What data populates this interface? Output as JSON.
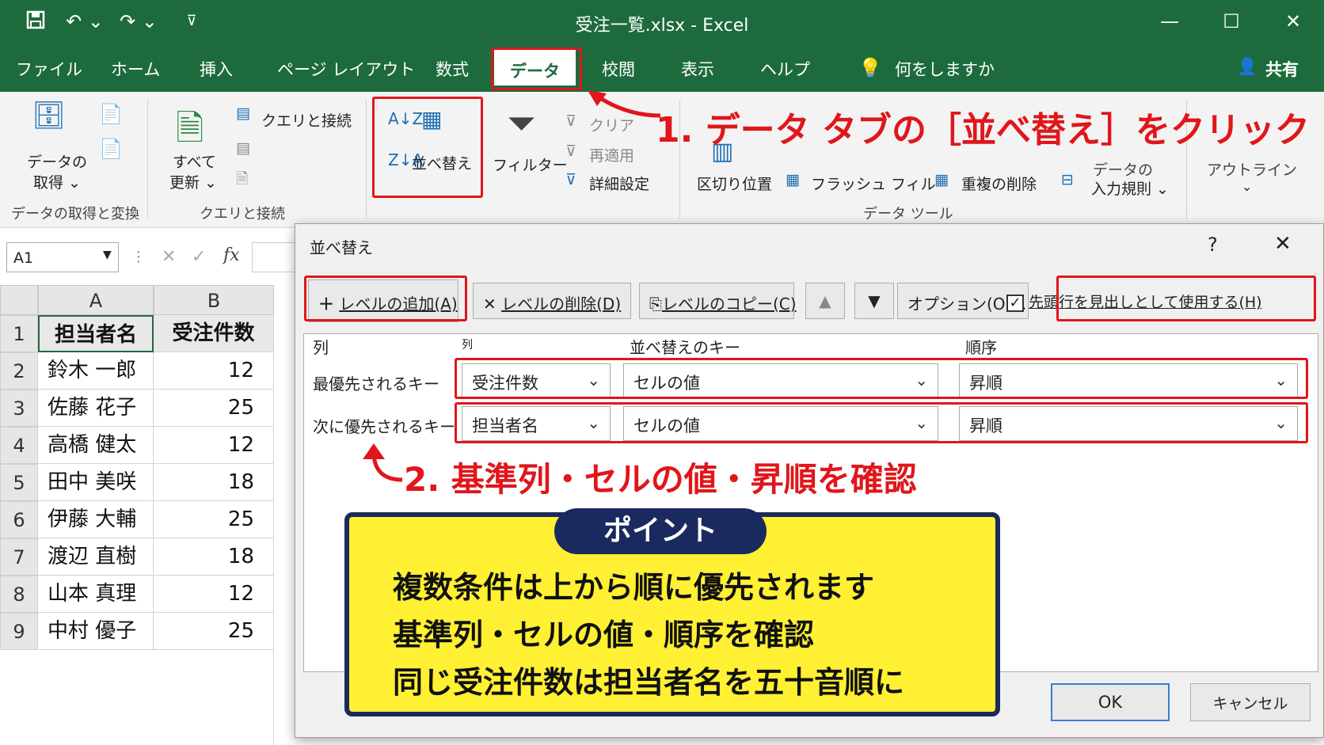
{
  "window": {
    "title": "受注一覧.xlsx - Excel"
  },
  "tabs": [
    "ファイル",
    "ホーム",
    "挿入",
    "ページ レイアウト",
    "数式",
    "データ",
    "校閲",
    "表示",
    "ヘルプ"
  ],
  "tell_me": "何をしますか",
  "share": "共有",
  "ribbon": {
    "get_data": [
      "データの",
      "取得 ⌄"
    ],
    "refresh_all": [
      "すべて",
      "更新 ⌄"
    ],
    "queries": "クエリと接続",
    "sort": "並べ替え",
    "filter": "フィルター",
    "clear": "クリア",
    "reapply": "再適用",
    "advanced": "詳細設定",
    "text_to_columns": "区切り位置",
    "flash_fill": "フラッシュ フィル",
    "remove_dup": "重複の削除",
    "validation": [
      "データの",
      "入力規則 ⌄"
    ],
    "outline": "アウトライン",
    "groups": {
      "get_transform": "データの取得と変換",
      "queries": "クエリと接続",
      "data_tools": "データ ツール"
    }
  },
  "formula_bar": {
    "name_box": "A1",
    "fx": "fx"
  },
  "sheet": {
    "columns": [
      "A",
      "B"
    ],
    "rows": [
      [
        "1",
        "担当者名",
        "受注件数"
      ],
      [
        "2",
        "鈴木 一郎",
        "12"
      ],
      [
        "3",
        "佐藤 花子",
        "25"
      ],
      [
        "4",
        "高橋 健太",
        "12"
      ],
      [
        "5",
        "田中 美咲",
        "18"
      ],
      [
        "6",
        "伊藤 大輔",
        "25"
      ],
      [
        "7",
        "渡辺 直樹",
        "18"
      ],
      [
        "8",
        "山本 真理",
        "12"
      ],
      [
        "9",
        "中村 優子",
        "25"
      ]
    ]
  },
  "dialog": {
    "title": "並べ替え",
    "help": "?",
    "add_level": "レベルの追加(A)",
    "delete_level": "レベルの削除(D)",
    "copy_level": "レベルのコピー(C)",
    "options": "オプション(O)...",
    "has_header": "先頭行を見出しとして使用する(H)",
    "header_checked": true,
    "col_headers": {
      "col": "列",
      "col2": "列",
      "key": "並べ替えのキー",
      "order": "順序"
    },
    "levels": [
      {
        "label": "最優先されるキー",
        "column": "受注件数",
        "key": "セルの値",
        "order": "昇順"
      },
      {
        "label": "次に優先されるキー",
        "column": "担当者名",
        "key": "セルの値",
        "order": "昇順"
      }
    ],
    "ok": "OK",
    "cancel": "キャンセル"
  },
  "annotations": {
    "step1": "1. データ タブの［並べ替え］をクリック",
    "step2": "2. 基準列・セルの値・昇順を確認",
    "point_title": "ポイント",
    "point_lines": [
      "複数条件は上から順に優先されます",
      "基準列・セルの値・順序を確認",
      "同じ受注件数は担当者名を五十音順に"
    ]
  },
  "colors": {
    "excel_green": "#1d6b3c",
    "highlight_red": "#e0161b",
    "point_yellow": "#fff033",
    "point_navy": "#1b2a5e"
  }
}
